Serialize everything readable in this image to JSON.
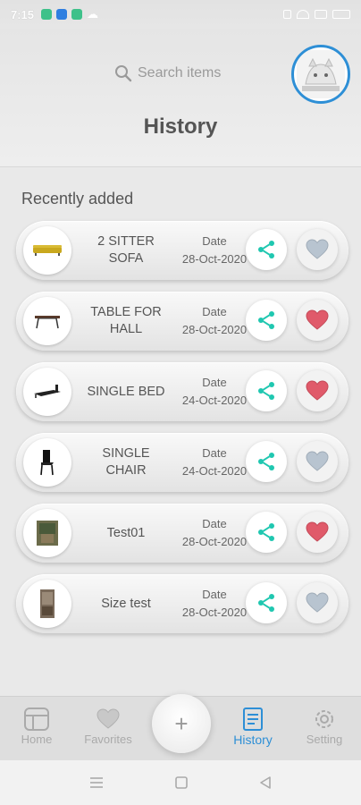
{
  "status_bar": {
    "time": "7:15"
  },
  "header": {
    "search_placeholder": "Search items",
    "title": "History"
  },
  "section": {
    "label": "Recently added"
  },
  "items": [
    {
      "name": "2 SITTER SOFA",
      "date_label": "Date",
      "date": "28-Oct-2020",
      "thumb": "sofa",
      "favorite": false
    },
    {
      "name": "TABLE FOR HALL",
      "date_label": "Date",
      "date": "28-Oct-2020",
      "thumb": "table",
      "favorite": true
    },
    {
      "name": "SINGLE BED",
      "date_label": "Date",
      "date": "24-Oct-2020",
      "thumb": "bed",
      "favorite": true
    },
    {
      "name": "SINGLE CHAIR",
      "date_label": "Date",
      "date": "24-Oct-2020",
      "thumb": "chair",
      "favorite": false
    },
    {
      "name": "Test01",
      "date_label": "Date",
      "date": "28-Oct-2020",
      "thumb": "photo",
      "favorite": true
    },
    {
      "name": "Size test",
      "date_label": "Date",
      "date": "28-Oct-2020",
      "thumb": "photo2",
      "favorite": false
    }
  ],
  "bottom_nav": {
    "home": "Home",
    "favorites": "Favorites",
    "add": "+",
    "history": "History",
    "setting": "Setting",
    "active": "history"
  },
  "colors": {
    "accent": "#2e8fd6",
    "share": "#1fc7b0",
    "heart_on": "#e05a6a",
    "heart_off": "#b8c4d0"
  }
}
